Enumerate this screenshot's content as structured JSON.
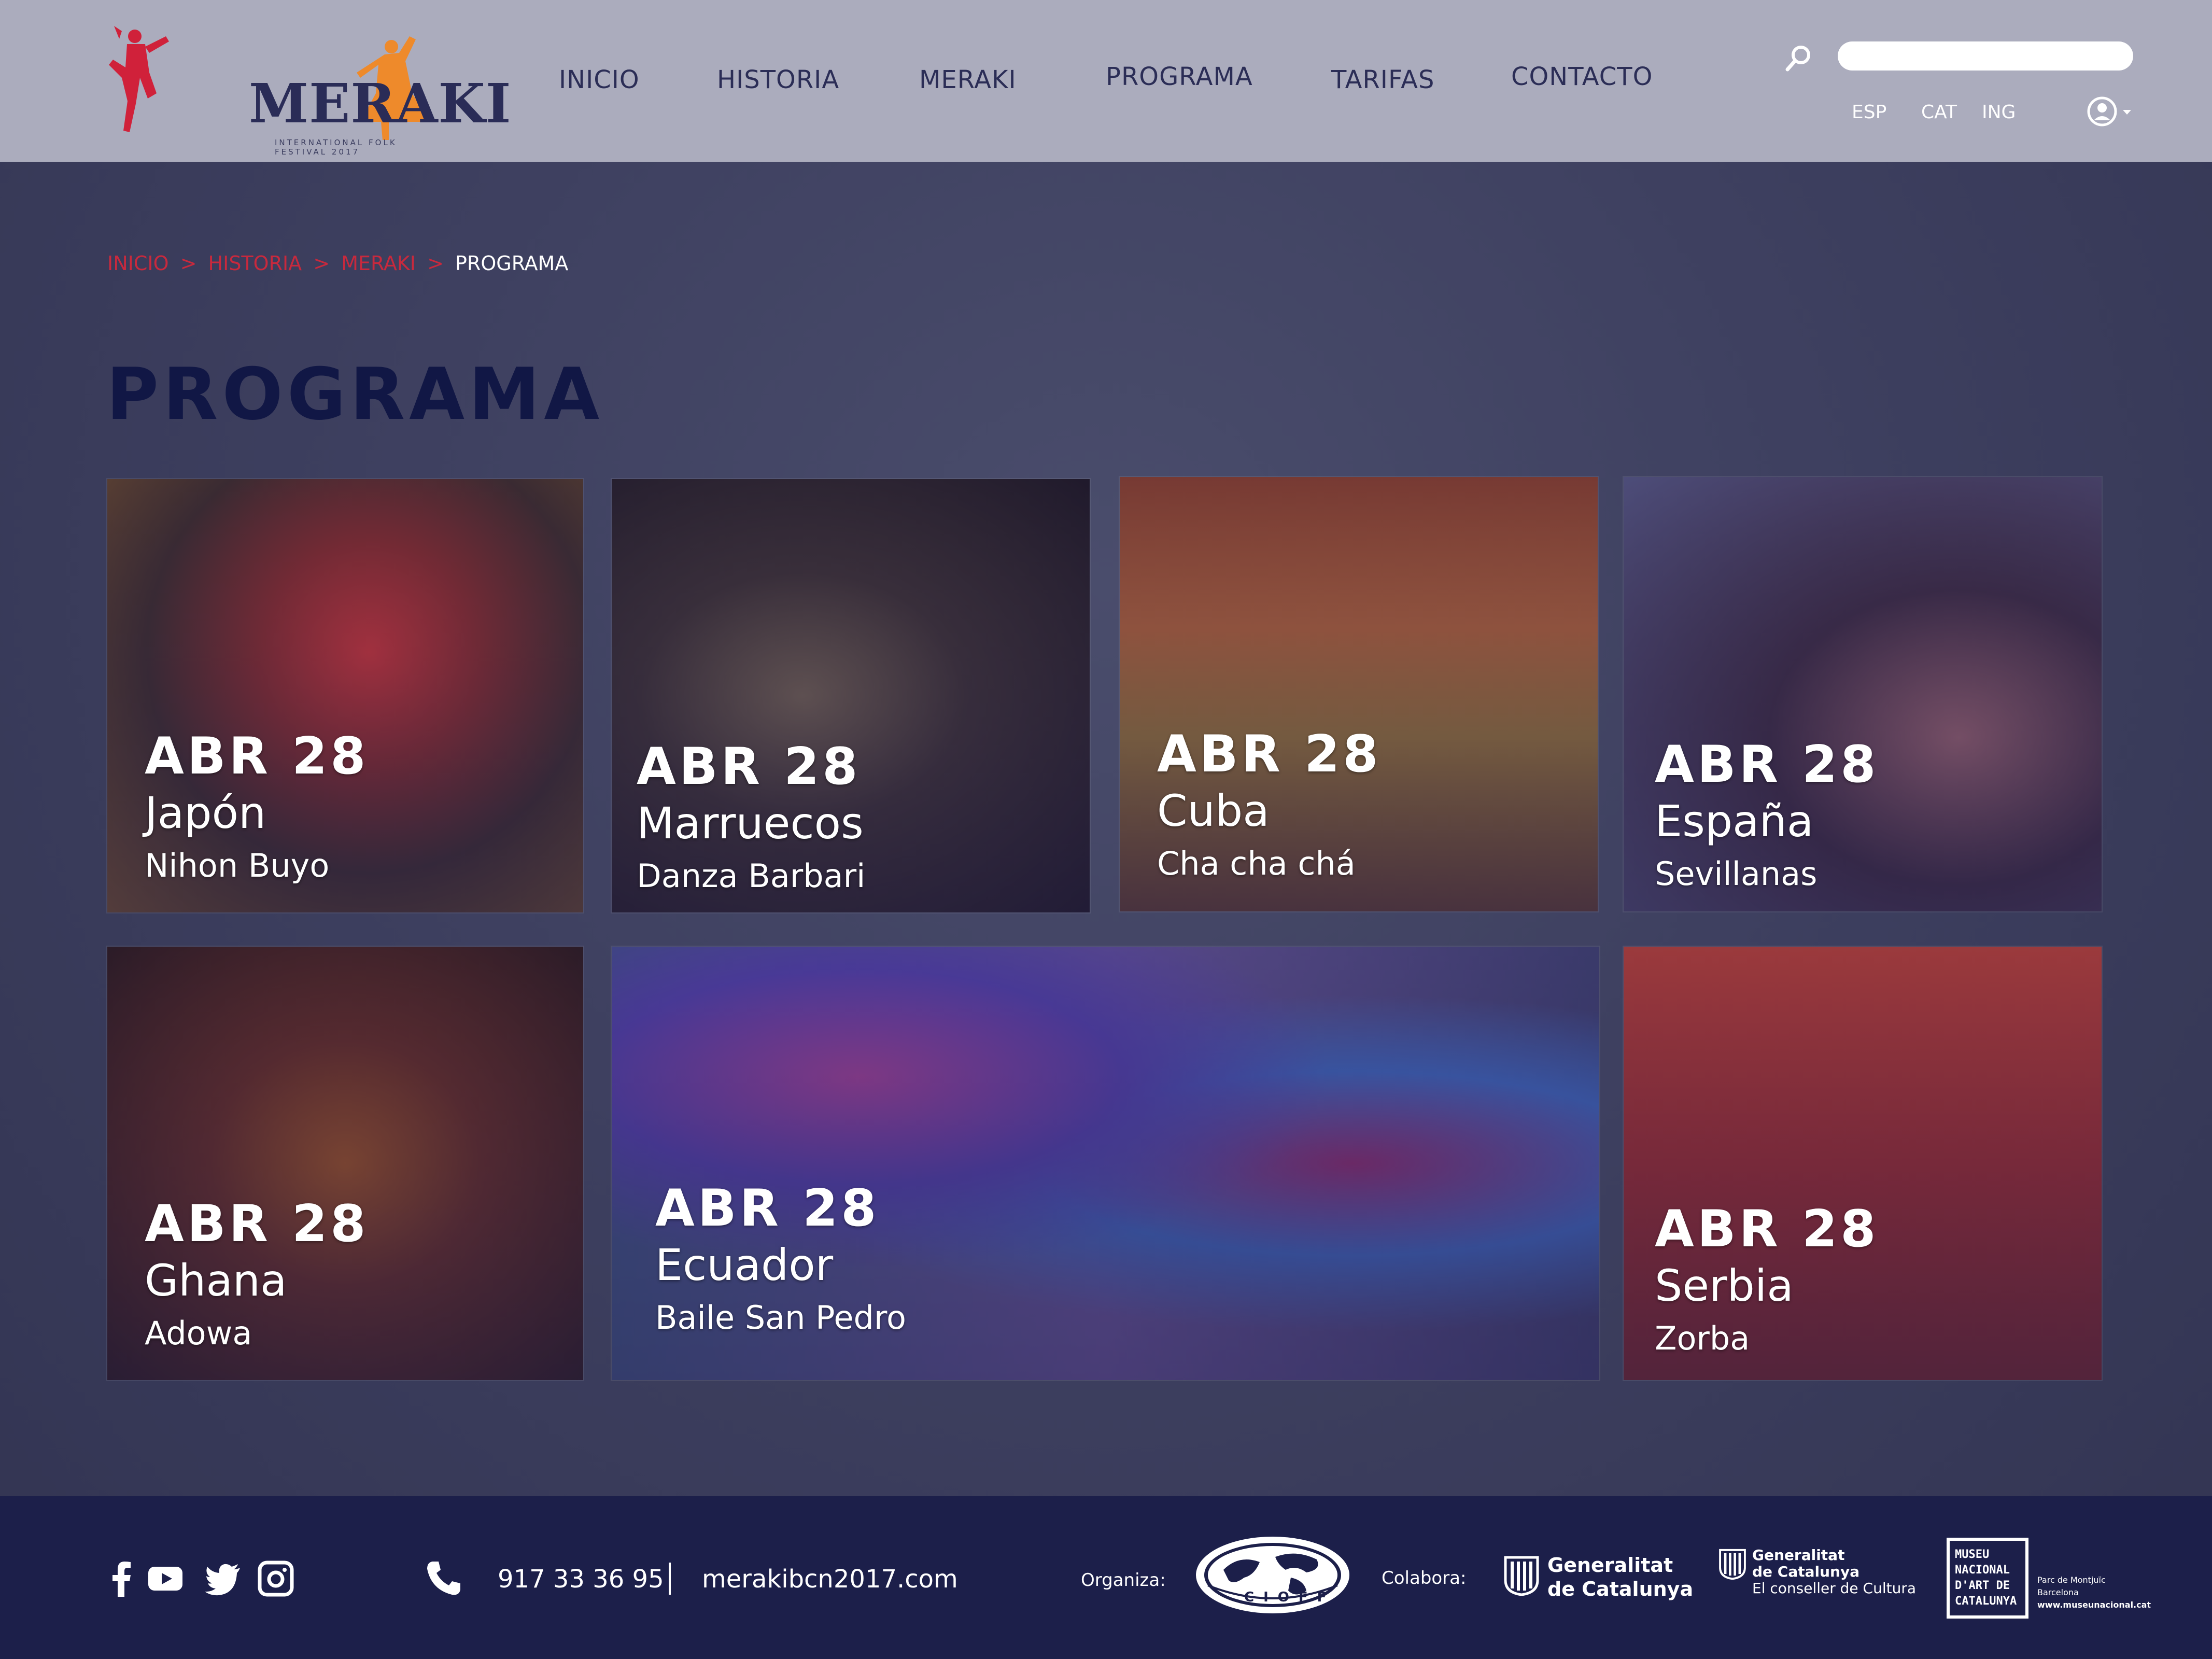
{
  "header": {
    "logo": {
      "name": "MERAKI",
      "subtitle": "INTERNATIONAL FOLK FESTIVAL 2017"
    },
    "nav": [
      {
        "label": "INICIO"
      },
      {
        "label": "HISTORIA"
      },
      {
        "label": "MERAKI"
      },
      {
        "label": "PROGRAMA"
      },
      {
        "label": "TARIFAS"
      },
      {
        "label": "CONTACTO"
      }
    ],
    "search": {
      "placeholder": "",
      "value": ""
    },
    "languages": [
      "ESP",
      "CAT",
      "ING"
    ]
  },
  "breadcrumb": {
    "items": [
      "INICIO",
      "HISTORIA",
      "MERAKI"
    ],
    "separator": ">",
    "current": "PROGRAMA"
  },
  "page_title": "PROGRAMA",
  "cards": [
    {
      "date": "ABR 28",
      "country": "Japón",
      "dance": "Nihon Buyo"
    },
    {
      "date": "ABR 28",
      "country": "Marruecos",
      "dance": "Danza Barbari"
    },
    {
      "date": "ABR 28",
      "country": "Cuba",
      "dance": "Cha cha chá"
    },
    {
      "date": "ABR 28",
      "country": "España",
      "dance": "Sevillanas"
    },
    {
      "date": "ABR 28",
      "country": "Ghana",
      "dance": "Adowa"
    },
    {
      "date": "ABR 28",
      "country": "Ecuador",
      "dance": "Baile San Pedro"
    },
    {
      "date": "ABR 28",
      "country": "Serbia",
      "dance": "Zorba"
    }
  ],
  "footer": {
    "social_icons": [
      "facebook-icon",
      "youtube-icon",
      "twitter-icon",
      "instagram-icon"
    ],
    "phone": "917 33 36 95",
    "divider": "|",
    "website": "merakibcn2017.com",
    "organiza_label": "Organiza:",
    "cioff": "CIOFF",
    "colabora_label": "Colabora:",
    "generalitat_1": {
      "line1": "Generalitat",
      "line2": "de Catalunya"
    },
    "generalitat_2": {
      "line1": "Generalitat",
      "line2": "de Catalunya",
      "line3": "El conseller de Cultura"
    },
    "museu": {
      "line1": "MUSEU",
      "line2": "NACIONAL",
      "line3": "D'ART DE",
      "line4": "CATALUNYA",
      "side1": "Parc de Montjuïc",
      "side2": "Barcelona",
      "side3": "www.museunacional.cat"
    }
  },
  "colors": {
    "accent_red": "#c8293d",
    "title_navy": "#111745",
    "header_bg": "#abacbd",
    "footer_bg": "#1c1f4a"
  }
}
